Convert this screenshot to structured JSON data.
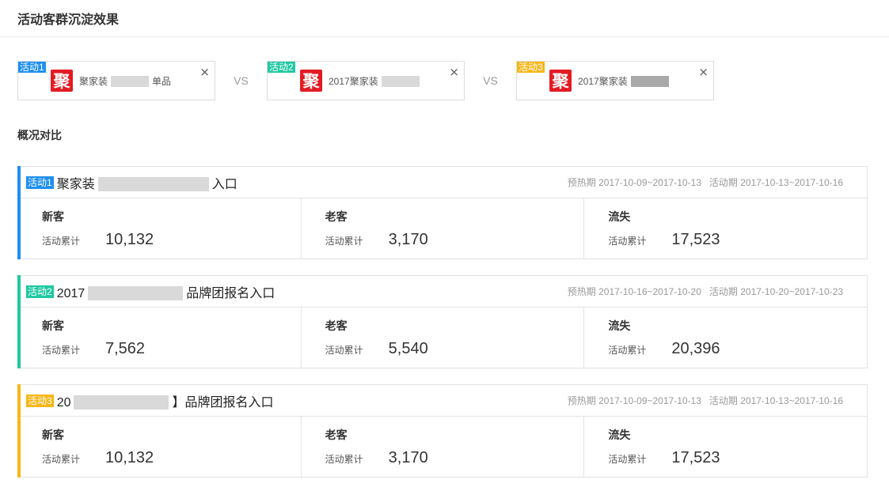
{
  "header": {
    "title": "活动客群沉淀效果"
  },
  "compare": {
    "vs_label": "VS",
    "close_glyph": "×",
    "activities": [
      {
        "tag": "活动1",
        "logo_char": "聚",
        "name_prefix": "聚家装",
        "name_suffix": "单品",
        "color": "#1e8ff0"
      },
      {
        "tag": "活动2",
        "logo_char": "聚",
        "name_prefix": "2017聚家装",
        "name_suffix": "",
        "color": "#1fc8a2"
      },
      {
        "tag": "活动3",
        "logo_char": "聚",
        "name_prefix": "2017聚家装",
        "name_suffix": "",
        "color": "#f7b617"
      }
    ]
  },
  "overview": {
    "title": "概况对比",
    "metric_labels": {
      "new": "新客",
      "old": "老客",
      "lost": "流失",
      "cumulative": "活动累计"
    },
    "summaries": [
      {
        "tag": "活动1",
        "name_prefix": "聚家装",
        "name_suffix": "入口",
        "preheat": "预热期 2017-10-09~2017-10-13",
        "active": "活动期 2017-10-13~2017-10-16",
        "new": "10,132",
        "old": "3,170",
        "lost": "17,523",
        "color": "#1e8ff0"
      },
      {
        "tag": "活动2",
        "name_prefix": "2017",
        "name_suffix": "品牌团报名入口",
        "preheat": "预热期 2017-10-16~2017-10-20",
        "active": "活动期 2017-10-20~2017-10-23",
        "new": "7,562",
        "old": "5,540",
        "lost": "20,396",
        "color": "#1fc8a2"
      },
      {
        "tag": "活动3",
        "name_prefix": "20",
        "name_suffix": "】品牌团报名入口",
        "preheat": "预热期 2017-10-09~2017-10-13",
        "active": "活动期 2017-10-13~2017-10-16",
        "new": "10,132",
        "old": "3,170",
        "lost": "17,523",
        "color": "#f7b617"
      }
    ]
  }
}
